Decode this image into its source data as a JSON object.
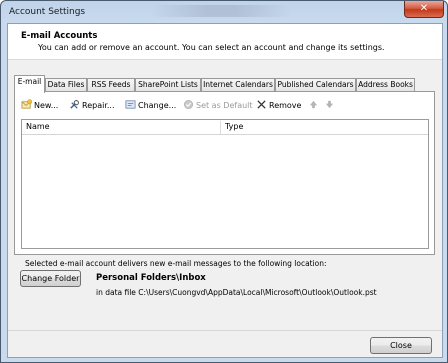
{
  "window": {
    "title": "Account Settings",
    "close_glyph": "✕"
  },
  "header": {
    "title": "E-mail Accounts",
    "subtitle": "You can add or remove an account. You can select an account and change its settings."
  },
  "tabs": [
    {
      "label": "E-mail",
      "active": true
    },
    {
      "label": "Data Files"
    },
    {
      "label": "RSS Feeds"
    },
    {
      "label": "SharePoint Lists"
    },
    {
      "label": "Internet Calendars"
    },
    {
      "label": "Published Calendars"
    },
    {
      "label": "Address Books"
    }
  ],
  "toolbar": {
    "new_label": "New...",
    "repair_label": "Repair...",
    "change_label": "Change...",
    "default_label": "Set as Default",
    "remove_label": "Remove",
    "up_icon": "up-arrow-icon",
    "down_icon": "down-arrow-icon"
  },
  "grid": {
    "columns": [
      "Name",
      "Type"
    ],
    "rows": []
  },
  "delivery": {
    "info": "Selected e-mail account delivers new e-mail messages to the following location:",
    "change_folder_label": "Change Folder",
    "folder_title": "Personal Folders\\Inbox",
    "folder_path": "in data file C:\\Users\\Cuongvd\\AppData\\Local\\Microsoft\\Outlook\\Outlook.pst"
  },
  "footer": {
    "close_label": "Close"
  },
  "colors": {
    "frame": "#c9daee",
    "client": "#f0f0f0",
    "close_red": "#c4381b"
  }
}
